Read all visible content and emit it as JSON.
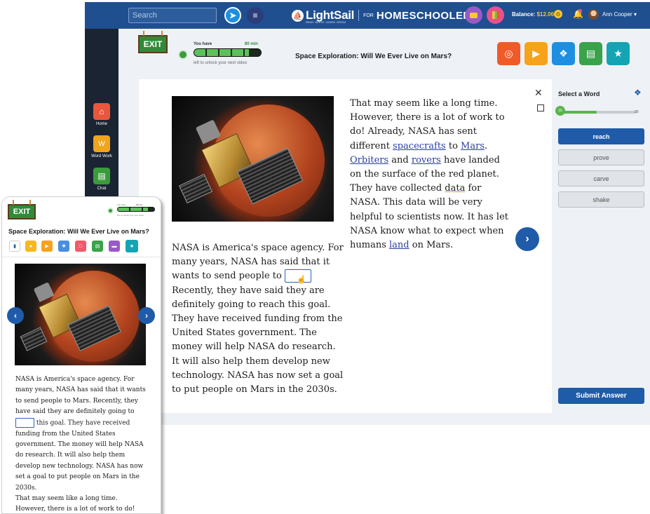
{
  "colors": {
    "topbar": "#1f4f8f",
    "nav": "#1a2433",
    "primary_blue": "#1f5ba8",
    "exit_green": "#2f8b3a",
    "time_green": "#5cc15a"
  },
  "topbar": {
    "search_placeholder": "Search",
    "logo_name": "LightSail",
    "logo_tagline": "READ. WRITE. LEARN. GROW.",
    "logo_for": "FOR",
    "logo_sub": "HOMESCHOOLERS",
    "balance_label": "Balance:",
    "balance_value": "$12.06",
    "user_name": "Ann Cooper"
  },
  "nav": {
    "items": [
      {
        "label": "Home",
        "icon": "home-icon",
        "color": "#e8573c"
      },
      {
        "label": "Word Work",
        "icon": "word-work-icon",
        "color": "#f0a51d"
      },
      {
        "label": "Chat",
        "icon": "chat-icon",
        "color": "#3a9b3a"
      }
    ]
  },
  "header": {
    "exit_label": "EXIT",
    "time_prefix": "You have",
    "time_value": "80",
    "time_unit": "min",
    "time_sub": "left to unlock your next video",
    "time_progress": 0.82,
    "title": "Space Exploration: Will We Ever Live on Mars?",
    "tools": [
      {
        "icon": "target-icon",
        "color": "#f05a28"
      },
      {
        "icon": "play-icon",
        "color": "#f7a21b"
      },
      {
        "icon": "ear-icon",
        "color": "#1e8fe0"
      },
      {
        "icon": "book-icon",
        "color": "#3aa24a"
      },
      {
        "icon": "star-icon",
        "color": "#14a4b3"
      }
    ]
  },
  "reader": {
    "para1_before": "NASA is America's space agency. For many years, NASA has said that it wants to send people to",
    "para1_after": "Recently, they have said they are definitely going to reach this goal. They have received funding from the United States government. The money will help NASA do research. It will also help them develop new technology. NASA has now set a goal to put people on Mars in the 2030s.",
    "para2": {
      "t1": "That may seem like a long time. However, there is a lot of work to do! Already, NASA has sent different ",
      "link1": "spacecrafts",
      "t2": " to ",
      "link2": "Mars",
      "t3": ". ",
      "link3": "Orbiters",
      "t4": " and ",
      "link4": "rovers",
      "t5": " have landed on the surface of the red planet. They have collected ",
      "link5": "data",
      "t6": " for NASA. This data will be very helpful to scientists now. It has let NASA know what to expect when humans ",
      "link6": "land",
      "t7": " on Mars."
    }
  },
  "wordpanel": {
    "title": "Select a Word",
    "progress_start": "15",
    "progress_end": "20",
    "progress_fraction": 0.48,
    "choices": [
      "reach",
      "prove",
      "carve",
      "shake"
    ],
    "selected": "reach",
    "submit_label": "Submit Answer"
  },
  "phone": {
    "exit_label": "EXIT",
    "time_prefix": "You have",
    "time_value": "80 min",
    "time_sub": "left to unlock your next video",
    "title": "Space Exploration: Will We Ever Live on Mars?",
    "tools": [
      {
        "icon": "sidebar-icon",
        "color": "#1f5ba8"
      },
      {
        "icon": "lightbulb-icon",
        "color": "#f7b81b"
      },
      {
        "icon": "play-icon",
        "color": "#f7a21b"
      },
      {
        "icon": "ear-icon",
        "color": "#4a8de0"
      },
      {
        "icon": "comment-icon",
        "color": "#f05a6a"
      },
      {
        "icon": "book-icon",
        "color": "#3aa24a"
      },
      {
        "icon": "folder-icon",
        "color": "#9a59c9"
      },
      {
        "icon": "star-icon",
        "color": "#14a4b3"
      }
    ],
    "text_before": "NASA is America's space agency. For many years, NASA has said that it wants to send people to Mars. Recently, they have said they are definitely going to",
    "text_after": "this goal. They have received funding from the United States government. The money will help NASA do research. It will also help them develop new technology. NASA has now set a goal to put people on Mars in the 2030s.",
    "text_more": "That may seem like a long time. However, there is a lot of work to do!"
  }
}
